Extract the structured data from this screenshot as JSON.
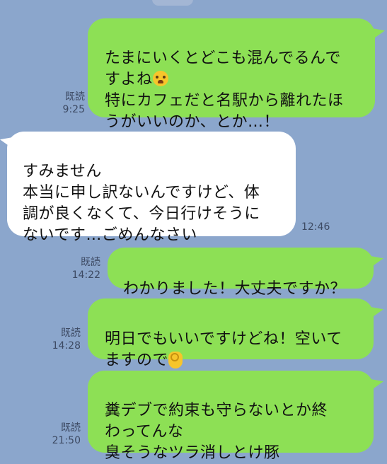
{
  "messages": [
    {
      "side": "out",
      "text_before": "たまにいくとどこも混んでるんで\nすよね",
      "emoji": "crying-face",
      "text_after": "\n特にカフェだと名駅から離れたほ\nうがいいのか、とか…！",
      "read": "既読",
      "time": "9:25"
    },
    {
      "side": "in",
      "text": "すみません\n本当に申し訳ないんですけど、体\n調が良くなくて、今日行けそうに\nないです…ごめんなさい",
      "time": "12:46"
    },
    {
      "side": "out",
      "text": "わかりました！大丈夫ですか？",
      "read": "既読",
      "time": "14:22"
    },
    {
      "side": "out",
      "text_before": "明日でもいいですけどね！空いて\nますので",
      "emoji": "ok-hand",
      "text_after": "",
      "read": "既読",
      "time": "14:28"
    },
    {
      "side": "out",
      "text": "糞デブで約束も守らないとか終\nわってんな\n臭そうなツラ消しとけ豚",
      "read": "既読",
      "time": "21:50"
    }
  ],
  "colors": {
    "background": "#8ba6cc",
    "outgoing_bubble": "#8de055",
    "incoming_bubble": "#ffffff",
    "meta_text": "#3d4a63"
  }
}
